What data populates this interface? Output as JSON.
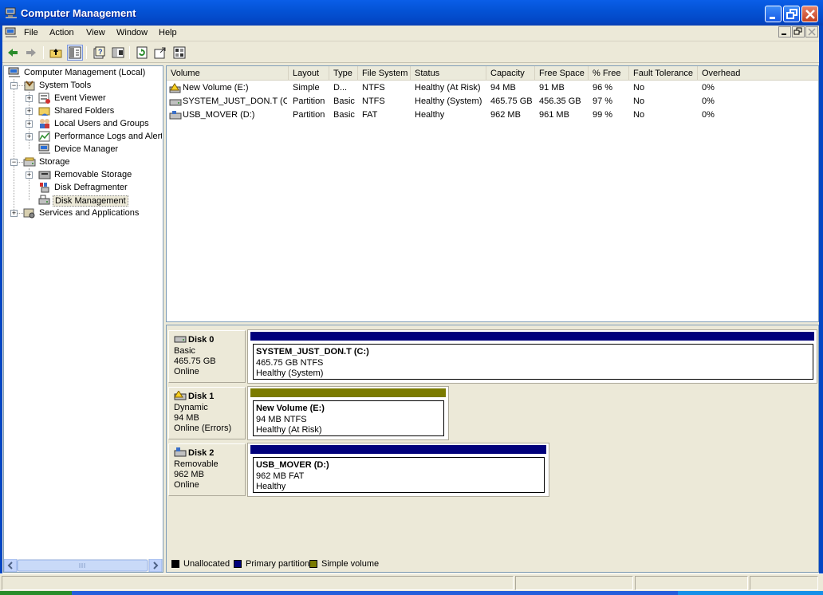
{
  "window": {
    "title": "Computer Management",
    "minimize_icon": "minimize-icon",
    "maximize_icon": "restore-icon",
    "close_icon": "close-icon"
  },
  "menu": {
    "items": [
      "File",
      "Action",
      "View",
      "Window",
      "Help"
    ]
  },
  "toolbar": {
    "icons": [
      "back-arrow-icon",
      "forward-arrow-icon",
      "up-folder-icon",
      "show-hide-tree-icon",
      "properties-icon",
      "help-icon",
      "refresh-icon",
      "export-list-icon",
      "settings-icon"
    ]
  },
  "tree": {
    "root": "Computer Management (Local)",
    "system_tools": "System Tools",
    "event_viewer": "Event Viewer",
    "shared_folders": "Shared Folders",
    "local_users": "Local Users and Groups",
    "perf_logs": "Performance Logs and Alerts",
    "device_manager": "Device Manager",
    "storage": "Storage",
    "removable_storage": "Removable Storage",
    "disk_defrag": "Disk Defragmenter",
    "disk_management": "Disk Management",
    "services": "Services and Applications",
    "expand_symbol": "+",
    "collapse_symbol": "−"
  },
  "volumes": {
    "columns": [
      "Volume",
      "Layout",
      "Type",
      "File System",
      "Status",
      "Capacity",
      "Free Space",
      "% Free",
      "Fault Tolerance",
      "Overhead"
    ],
    "rows": [
      [
        "New Volume (E:)",
        "Simple",
        "D...",
        "NTFS",
        "Healthy (At Risk)",
        "94 MB",
        "91 MB",
        "96 %",
        "No",
        "0%"
      ],
      [
        "SYSTEM_JUST_DON.T (C:)",
        "Partition",
        "Basic",
        "NTFS",
        "Healthy (System)",
        "465.75 GB",
        "456.35 GB",
        "97 %",
        "No",
        "0%"
      ],
      [
        "USB_MOVER (D:)",
        "Partition",
        "Basic",
        "FAT",
        "Healthy",
        "962 MB",
        "961 MB",
        "99 %",
        "No",
        "0%"
      ]
    ]
  },
  "disks": [
    {
      "name": "Disk 0",
      "kind": "Basic",
      "size": "465.75 GB",
      "state": "Online",
      "part_name": "SYSTEM_JUST_DON.T  (C:)",
      "part_size": "465.75 GB NTFS",
      "part_status": "Healthy (System)",
      "bar_color": "#00007b"
    },
    {
      "name": "Disk 1",
      "kind": "Dynamic",
      "size": "94 MB",
      "state": "Online (Errors)",
      "part_name": "New Volume  (E:)",
      "part_size": "94 MB NTFS",
      "part_status": "Healthy (At Risk)",
      "bar_color": "#7b7b00"
    },
    {
      "name": "Disk 2",
      "kind": "Removable",
      "size": "962 MB",
      "state": "Online",
      "part_name": "USB_MOVER  (D:)",
      "part_size": "962 MB FAT",
      "part_status": "Healthy",
      "bar_color": "#00007b"
    }
  ],
  "legend": {
    "items": [
      {
        "label": "Unallocated",
        "color": "#000000"
      },
      {
        "label": "Primary partition",
        "color": "#00007b"
      },
      {
        "label": "Simple volume",
        "color": "#7b7b00"
      }
    ]
  },
  "colors": {
    "titlebar": "#0346c4",
    "chrome": "#ece9d8"
  }
}
